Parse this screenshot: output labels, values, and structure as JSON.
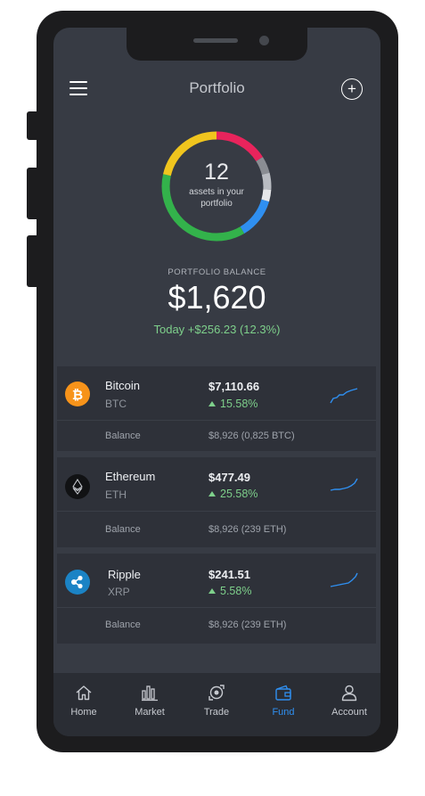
{
  "header": {
    "title": "Portfolio",
    "menu_icon": "hamburger-menu-icon",
    "add_icon": "plus-circle-icon"
  },
  "summary": {
    "asset_count": "12",
    "asset_caption": "assets in your portfolio",
    "balance_label": "PORTFOLIO BALANCE",
    "balance_value": "$1,620",
    "today_change": "Today +$256.23  (12.3%)",
    "ring_segments": [
      {
        "color": "#e8245c",
        "fraction": 0.16
      },
      {
        "color": "#8a8d93",
        "fraction": 0.05
      },
      {
        "color": "#b9bcc2",
        "fraction": 0.05
      },
      {
        "color": "#e6e7ea",
        "fraction": 0.035
      },
      {
        "color": "#2f8ff0",
        "fraction": 0.12
      },
      {
        "color": "#33b24b",
        "fraction": 0.37
      },
      {
        "color": "#f0c51e",
        "fraction": 0.215
      }
    ]
  },
  "coins": [
    {
      "name": "Bitcoin",
      "symbol": "BTC",
      "price": "$7,110.66",
      "change": "15.58%",
      "balance_label": "Balance",
      "balance": "$8,926  (0,825 BTC)",
      "icon": "bitcoin-icon",
      "icon_color": "#f7931a"
    },
    {
      "name": "Ethereum",
      "symbol": "ETH",
      "price": "$477.49",
      "change": "25.58%",
      "balance_label": "Balance",
      "balance": "$8,926  (239 ETH)",
      "icon": "ethereum-icon",
      "icon_color": "#111214"
    },
    {
      "name": "Ripple",
      "symbol": "XRP",
      "price": "$241.51",
      "change": "5.58%",
      "balance_label": "Balance",
      "balance": "$8,926  (239 ETH)",
      "icon": "ripple-icon",
      "icon_color": "#1b83c5"
    }
  ],
  "nav": [
    {
      "label": "Home",
      "icon": "home-icon"
    },
    {
      "label": "Market",
      "icon": "market-chart-icon"
    },
    {
      "label": "Trade",
      "icon": "trade-exchange-icon"
    },
    {
      "label": "Fund",
      "icon": "wallet-icon",
      "active": true
    },
    {
      "label": "Account",
      "icon": "user-icon"
    }
  ],
  "colors": {
    "accent": "#2f8ff0",
    "positive": "#7ed08b",
    "background": "#373b44",
    "card": "#2e3139"
  }
}
